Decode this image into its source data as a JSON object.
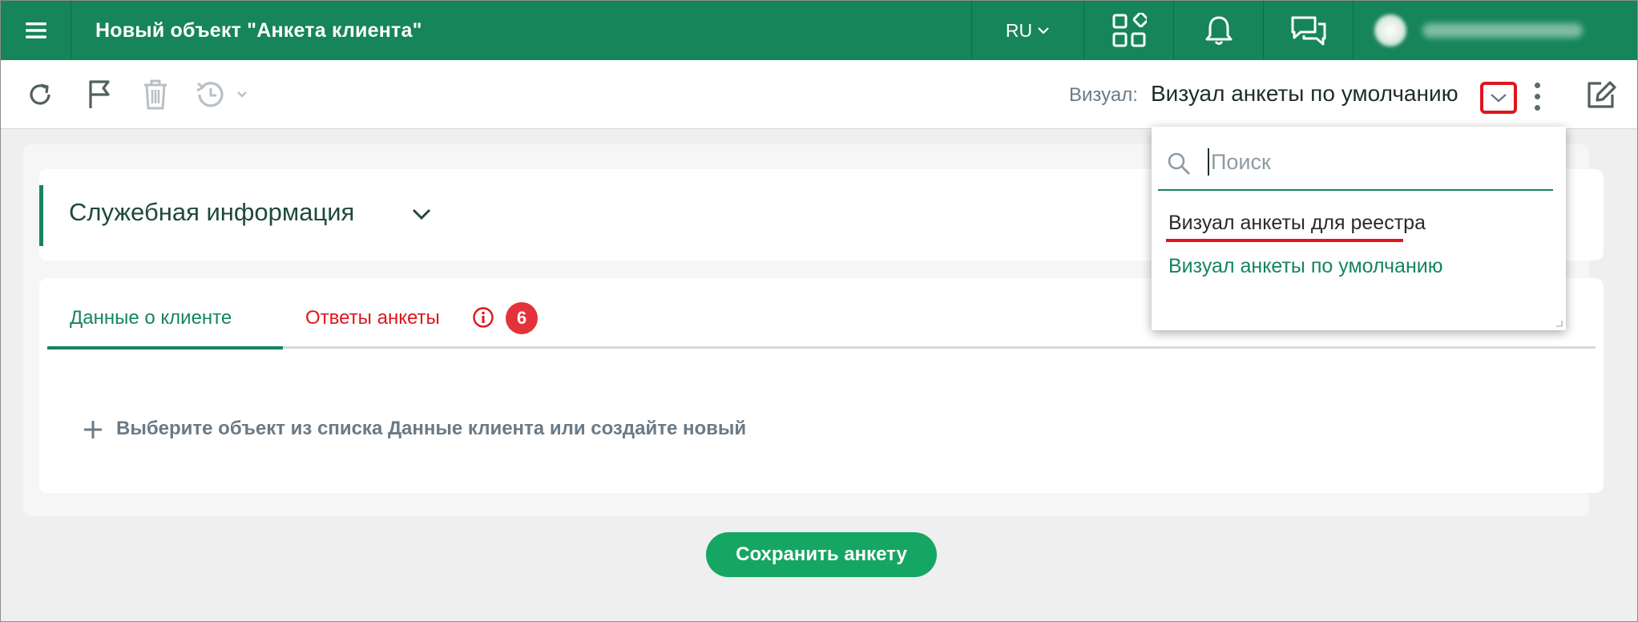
{
  "header": {
    "title": "Новый объект \"Анкета клиента\"",
    "language": "RU",
    "menu_icon": "hamburger-icon",
    "apps_icon": "apps-grid-icon",
    "notifications_icon": "bell-icon",
    "chat_icon": "chat-icon"
  },
  "toolbar": {
    "refresh_icon": "refresh-icon",
    "flag_icon": "flag-icon",
    "delete_icon": "trash-icon",
    "history_icon": "history-icon",
    "visual_label": "Визуал:",
    "visual_value": "Визуал анкеты по умолчанию",
    "edit_icon": "edit-icon"
  },
  "section": {
    "title": "Служебная информация"
  },
  "tabs": [
    {
      "label": "Данные о клиенте",
      "active": true
    },
    {
      "label": "Ответы анкеты",
      "badge": "6",
      "alert": true
    }
  ],
  "content": {
    "add_hint": "Выберите объект из списка Данные клиента или создайте новый"
  },
  "actions": {
    "save_label": "Сохранить анкету"
  },
  "dropdown": {
    "search_placeholder": "Поиск",
    "options": [
      {
        "label": "Визуал анкеты для реестра",
        "selected": false
      },
      {
        "label": "Визуал анкеты по умолчанию",
        "selected": true
      }
    ]
  },
  "colors": {
    "brand": "#16855a",
    "button": "#16a664",
    "alert": "#e0151d",
    "badge": "#e3323a"
  }
}
